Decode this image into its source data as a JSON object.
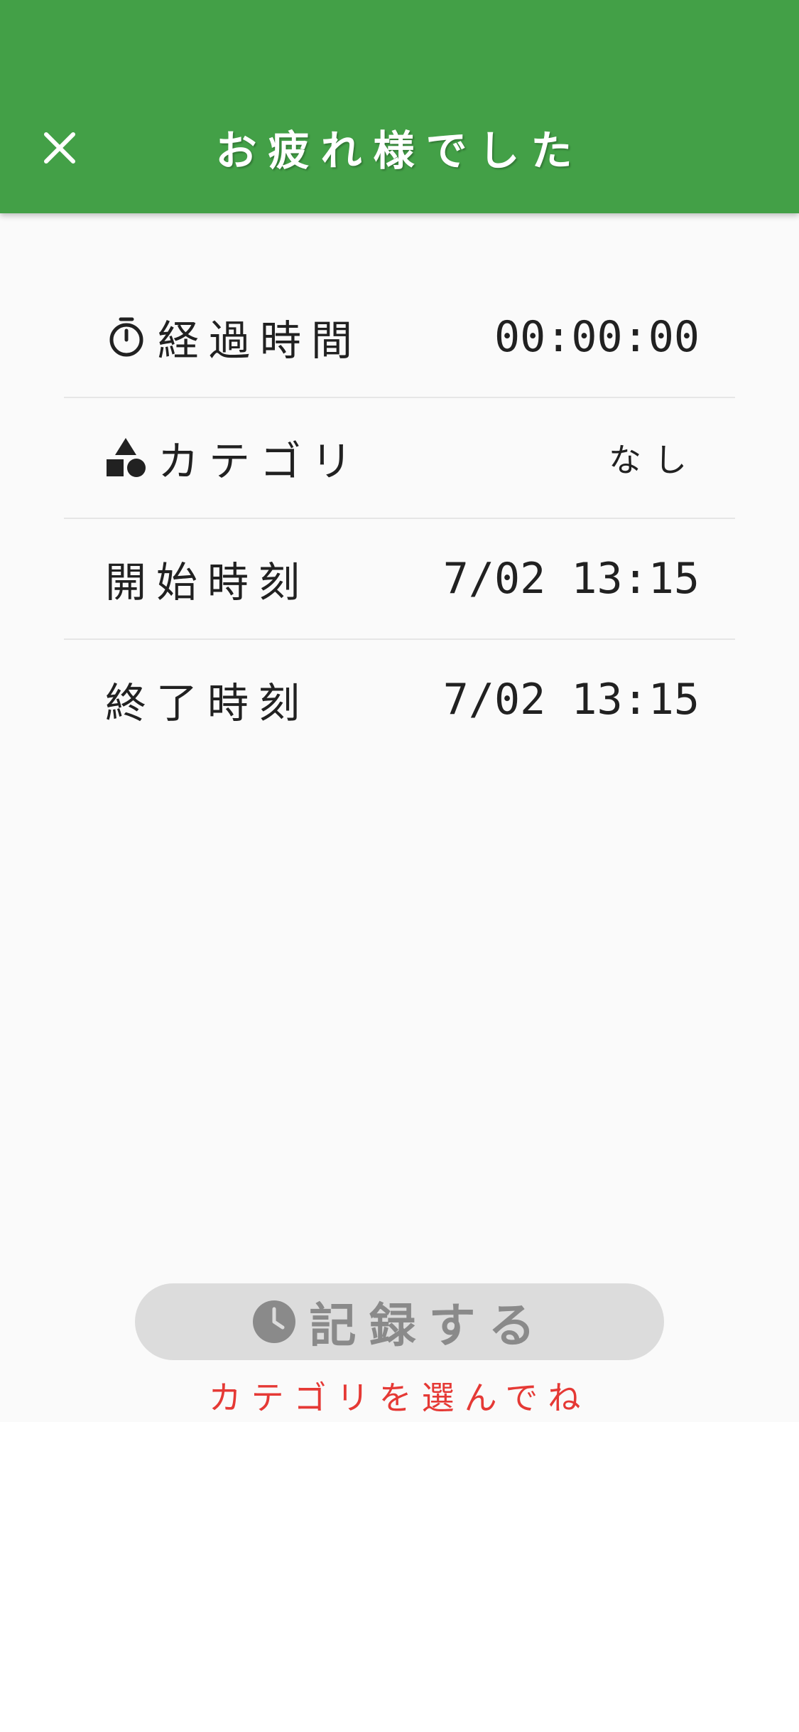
{
  "appbar": {
    "title": "お疲れ様でした",
    "color": "#43a047"
  },
  "rows": [
    {
      "icon": "stopwatch-icon",
      "label": "経過時間",
      "value": "00:00:00"
    },
    {
      "icon": "shapes-icon",
      "label": "カテゴリ",
      "value": "なし"
    },
    {
      "label": "開始時刻",
      "value": "7/02 13:15"
    },
    {
      "label": "終了時刻",
      "value": "7/02 13:15"
    }
  ],
  "record_button": {
    "label": "記録する",
    "icon": "clock-icon",
    "enabled": false
  },
  "hint": {
    "text": "カテゴリを選んでね",
    "color": "#e53935"
  }
}
